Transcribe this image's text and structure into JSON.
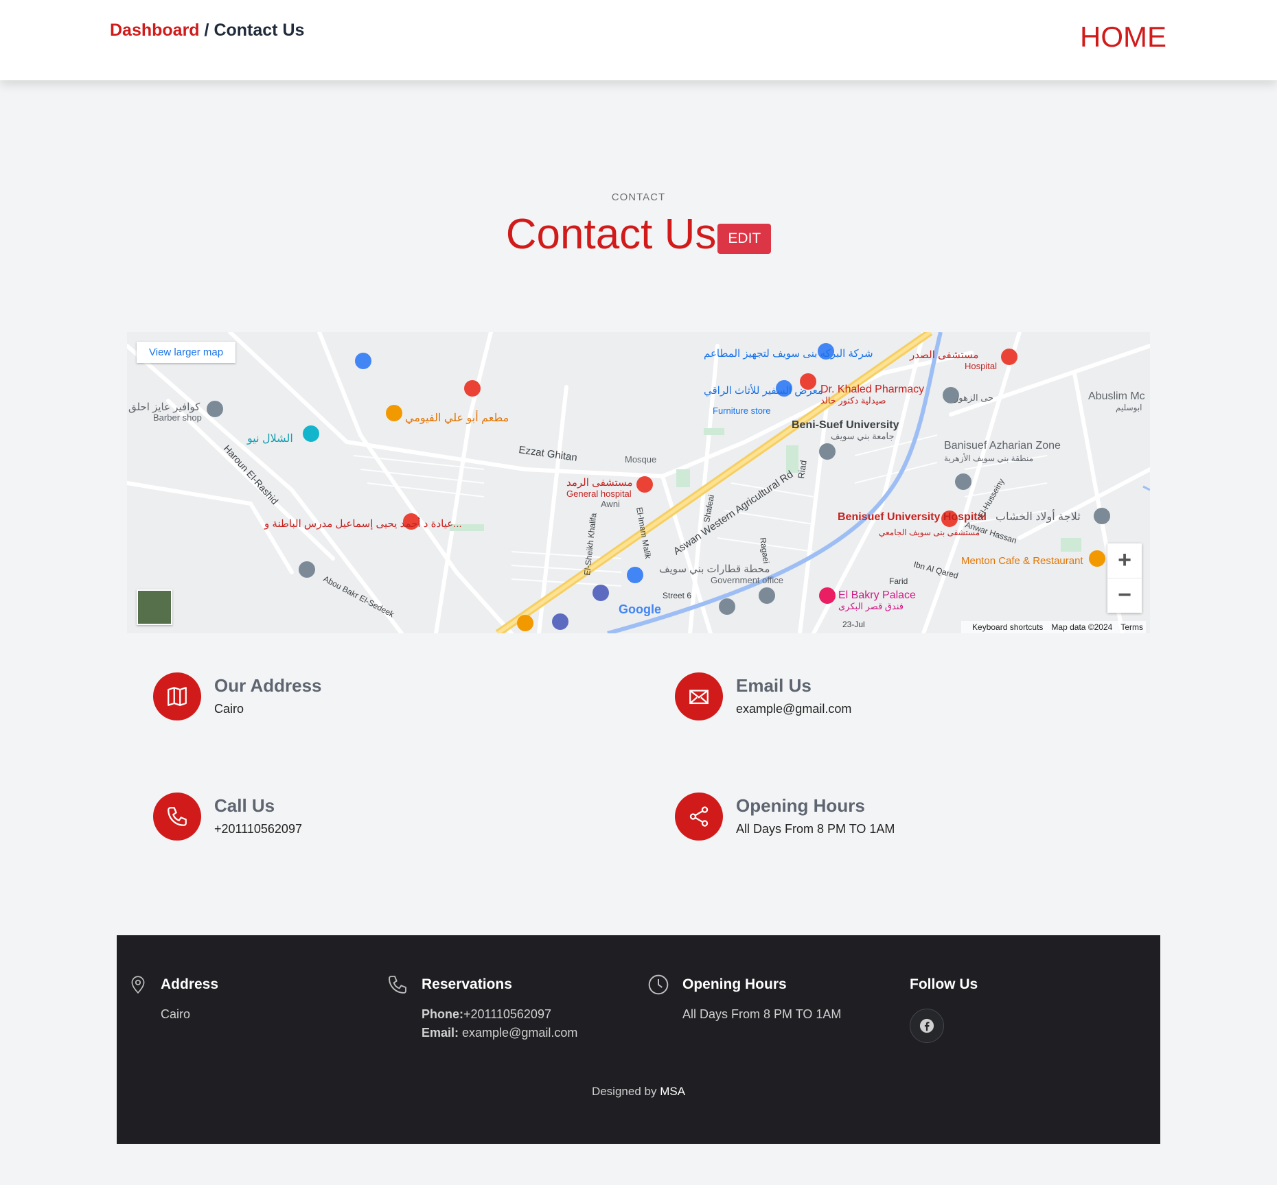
{
  "header": {
    "breadcrumb_link": "Dashboard",
    "breadcrumb_sep": "/",
    "breadcrumb_current": "Contact Us",
    "home_link": "HOME"
  },
  "section": {
    "eyebrow": "CONTACT",
    "title": "Contact Us",
    "edit_button": "EDIT"
  },
  "map": {
    "view_larger": "View larger map",
    "zoom_in": "+",
    "zoom_out": "−",
    "google_logo": "Google",
    "keyboard_shortcuts": "Keyboard shortcuts",
    "map_data": "Map data ©2024",
    "terms": "Terms",
    "labels": {
      "ezzat_ghitan": "Ezzat Ghitan",
      "awni": "Awni",
      "mosque": "Mosque",
      "haroun": "Haroun El-Rashid",
      "aswan_rd": "Aswan Western Agricultural Rd",
      "beni_suef_university": "Beni-Suef University",
      "beni_suef_university_ar": "جامعة بني سويف",
      "dr_khaled": "Dr. Khaled Pharmacy",
      "dr_khaled_ar": "صيدلية دكتور خالد",
      "furniture_ar": "معرض السفير للأثاث الراقي",
      "furniture": "Furniture store",
      "baraka_ar": "شركة البركه بنى سويف لتجهيز المطاعم",
      "hospital_ar": "مستشفى الصدر",
      "hospital": "Hospital",
      "abuslim": "Abuslim Mc",
      "abuslim_ar": "ابوسليم",
      "hay_zohour": "حى الزهور",
      "azhar_zone": "Banisuef Azharian Zone",
      "azhar_zone_ar": "منطقة بني سويف الأزهرية",
      "univ_hospital": "Benisuef University Hospital",
      "univ_hospital_ar": "مستشفى بنى سويف الجامعي",
      "khashab": "ثلاجة أولاد الخشاب",
      "menton": "Menton Cafe & Restaurant",
      "ramad_ar": "مستشفى الرمد",
      "general_hospital": "General hospital",
      "fayoumi_ar": "مطعم أبو علي الفيومي",
      "shallal_ar": "الشلال نيو",
      "barber_ar": "كوافير عايز احلق",
      "barber": "Barber shop",
      "clinic_ar": "عيادة د أحمد يحيى إسماعيل مدرس الباطنة و...",
      "station_ar": "محطة قطارات بني سويف",
      "gov_office": "Government office",
      "bakry": "El Bakry Palace",
      "bakry_ar": "فندق قصر البكرى",
      "street6": "Street 6",
      "jul23": "23-Jul",
      "farid": "Farid",
      "ibn_qared": "Ibn Al Qared",
      "anwar": "Anwar Hassan",
      "husseiny": "El-Husseiny",
      "abou_bakr": "Abou Bakr El-Sedeek",
      "shafeai": "Shafeai",
      "ragaei": "Ragaei",
      "riad": "Riad",
      "imam_malik": "El-Imam Malik",
      "sheikh_khalifa": "El-Sheikh Khalifa"
    }
  },
  "contact": {
    "address": {
      "label": "Our Address",
      "value": "Cairo",
      "icon": "map-icon"
    },
    "email": {
      "label": "Email Us",
      "value": "example@gmail.com",
      "icon": "envelope-icon"
    },
    "call": {
      "label": "Call Us",
      "value": "+201110562097",
      "icon": "phone-icon"
    },
    "hours": {
      "label": "Opening Hours",
      "value": "All Days From 8 PM TO 1AM",
      "icon": "share-icon"
    }
  },
  "footer": {
    "address_title": "Address",
    "address_value": "Cairo",
    "reservations_title": "Reservations",
    "phone_label": "Phone:",
    "phone_value": "+201110562097",
    "email_label": "Email:",
    "email_value": " example@gmail.com",
    "hours_title": "Opening Hours",
    "hours_value": "All Days From 8 PM TO 1AM",
    "follow_title": "Follow Us",
    "credit_prefix": "Designed by ",
    "credit_name": "MSA"
  },
  "colors": {
    "accent": "#d11a1a",
    "edit_button": "#dc3545",
    "footer_bg": "#1f1f23",
    "page_bg": "#f3f4f5"
  }
}
